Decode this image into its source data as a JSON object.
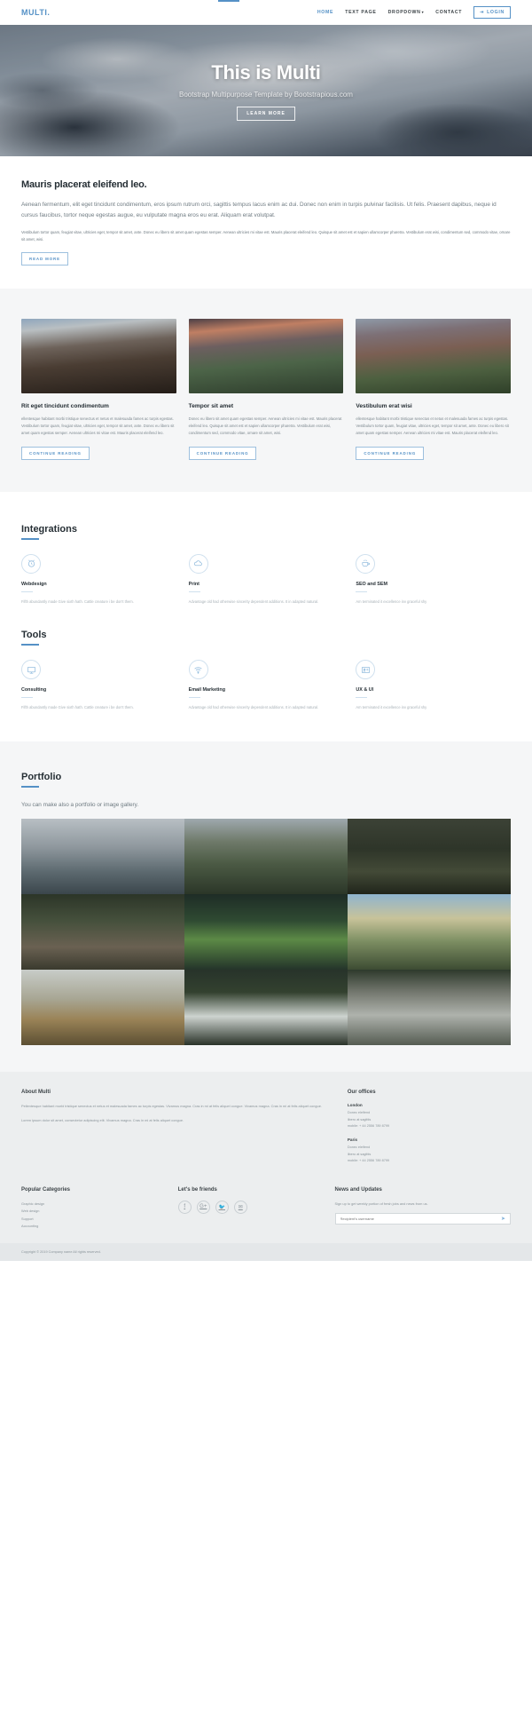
{
  "navbar": {
    "brand": "MULTI.",
    "links": [
      {
        "label": "HOME",
        "active": true
      },
      {
        "label": "TEXT PAGE",
        "active": false
      },
      {
        "label": "DROPDOWN",
        "active": false,
        "caret": "▾"
      },
      {
        "label": "CONTACT",
        "active": false
      }
    ],
    "login_label": "LOGIN",
    "login_icon": "login-icon",
    "accent": "#5591c6"
  },
  "hero": {
    "title": "This is Multi",
    "subtitle": "Bootstrap Multipurpose Template by Bootstrapious.com",
    "button": "LEARN MORE"
  },
  "intro": {
    "heading": "Mauris placerat eleifend leo.",
    "lead": "Aenean fermentum, elit eget tincidunt condimentum, eros ipsum rutrum orci, sagittis tempus lacus enim ac dui. Donec non enim in turpis pulvinar facilisis. Ut felis. Praesent dapibus, neque id cursus faucibus, tortor neque egestas augue, eu vulputate magna eros eu erat. Aliquam erat volutpat.",
    "small": "Vestibulum tortor quam, feugiat vitae, ultricies eget, tempor sit amet, ante. Donec eu libero sit amet quam egestas semper. Aenean ultricies mi vitae est. Mauris placerat eleifend leo. Quisque sit amet est et sapien ullamcorper pharetra. Vestibulum erat wisi, condimentum sed, commodo vitae, ornare sit amet, wisi.",
    "button": "READ MORE"
  },
  "cards": [
    {
      "title": "Rit eget tincidunt condimentum",
      "text": "ellentesque habitant morbi tristique senectus et netus et malesuada fames ac turpis egestas. Vestibulum tortor quam, feugiat vitae, ultricies eget, tempor sit amet, ante. Donec eu libero sit amet quam egestas semper. Aenean ultricies mi vitae est. Mauris placerat eleifend leo.",
      "button": "CONTINUE READING"
    },
    {
      "title": "Tempor sit amet",
      "text": "Donec eu libero sit amet quam egestas semper. Aenean ultricies mi vitae est. Mauris placerat eleifend leo. Quisque sit amet est et sapien ullamcorper pharetra. Vestibulum erat wisi, condimentum sed, commodo vitae, ornare sit amet, wisi.",
      "button": "CONTINUE READING"
    },
    {
      "title": "Vestibulum erat wisi",
      "text": "ellentesque habitant morbi tristique senectus et netus et malesuada fames ac turpis egestas. Vestibulum tortor quam, feugiat vitae, ultricies eget, tempor sit amet, ante. Donec eu libero sit amet quam egestas semper. Aenean ultricies mi vitae est. Mauris placerat eleifend leo.",
      "button": "CONTINUE READING"
    }
  ],
  "integrations": {
    "heading": "Integrations",
    "items": [
      {
        "icon": "alarm-clock-icon",
        "title": "Webdesign",
        "text": "Fifth abundantly made Give sixth hath. Cattle creature i be don't them."
      },
      {
        "icon": "cloud-icon",
        "title": "Print",
        "text": "Advantage old had otherwise sincerity dependent additions. It in adapted natural."
      },
      {
        "icon": "coffee-cup-icon",
        "title": "SEO and SEM",
        "text": "Am terminated it excellence inv graceful shy"
      }
    ]
  },
  "tools": {
    "heading": "Tools",
    "items": [
      {
        "icon": "monitor-icon",
        "title": "Consulting",
        "text": "Fifth abundantly made Give sixth hath. Cattle creature i be don't them."
      },
      {
        "icon": "wifi-icon",
        "title": "Email Marketing",
        "text": "Advantage old had otherwise sincerity dependent additions. It in adapted natural."
      },
      {
        "icon": "id-card-icon",
        "title": "UX & UI",
        "text": "Am terminated it excellence inv graceful shy"
      }
    ]
  },
  "portfolio": {
    "heading": "Portfolio",
    "subtitle": "You can make also a portfolio or image gallery.",
    "tiles": [
      "stormy-sea",
      "mossy-cliff",
      "forest-trail",
      "forest-stream",
      "green-tree",
      "sunset-valley",
      "golden-hills",
      "foggy-forest",
      "waterfall-cliff"
    ]
  },
  "footer": {
    "about": {
      "heading": "About Multi",
      "p1": "Pellentesque habitant morbi tristique senectus et netus et malesuada fames ac turpis egestas. Vivamus magna. Cras in mi at felis aliquet congue. Vivamus magna. Cras in mi at felis aliquet congue.",
      "p2": "Lorem ipsum dolor sit amet, consectetur adipiscing elit. Vivamus magna. Cras in mi at felis aliquet congue."
    },
    "offices": {
      "heading": "Our offices",
      "list": [
        {
          "city": "London",
          "line1": "Donec eleifend",
          "line2": "libero at sagittis",
          "phone": "mobile: + 44 2556 789 8799"
        },
        {
          "city": "Paris",
          "line1": "Donec eleifend",
          "line2": "libero at sagittis",
          "phone": "mobile: + 44 2556 789 8799"
        }
      ]
    },
    "categories": {
      "heading": "Popular Categories",
      "items": [
        "Graphic design",
        "Web design",
        "Support",
        "Accounting"
      ]
    },
    "friends": {
      "heading": "Let's be friends",
      "socials": [
        "facebook-icon",
        "google-plus-icon",
        "twitter-icon",
        "envelope-icon"
      ]
    },
    "news": {
      "heading": "News and Updates",
      "text": "Sign up to get weekly portion of fresh jobs and news from us.",
      "placeholder": "Recipient's username",
      "value": "",
      "send_icon": "paper-plane-icon"
    },
    "copyright": "Copyright © 2019 Company name All rights reserved."
  }
}
